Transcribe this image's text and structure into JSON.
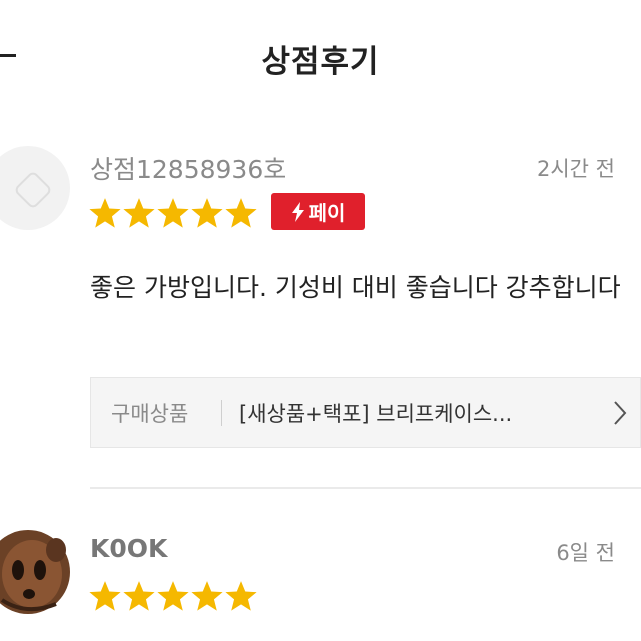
{
  "header": {
    "title": "상점후기"
  },
  "reviews": [
    {
      "username": "상점12858936호",
      "time": "2시간 전",
      "rating": 5,
      "badge": "페이",
      "text": "좋은 가방입니다. 기성비 대비 좋습니다 강추합니다",
      "product": {
        "label": "구매상품",
        "name": "[새상품+택포] 브리프케이스..."
      }
    },
    {
      "username": "K0OK",
      "time": "6일 전",
      "rating": 5
    }
  ],
  "colors": {
    "star": "#f5b800",
    "badge": "#e0202c",
    "accent_text": "#8a8a8a"
  },
  "icons": {
    "back": "back-arrow-icon",
    "chevron": "chevron-right-icon",
    "lightning": "lightning-icon"
  }
}
